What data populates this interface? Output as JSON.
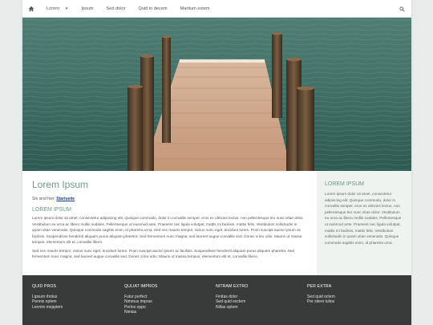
{
  "nav": {
    "items": [
      {
        "label": "Lorem",
        "has_dropdown": true
      },
      {
        "label": "Ipsum"
      },
      {
        "label": "Sed dolor"
      },
      {
        "label": "Quid in decem"
      },
      {
        "label": "Martium extem"
      }
    ],
    "home_icon": "home-icon",
    "search_icon": "search-icon"
  },
  "main": {
    "title": "Lorem Ipsum",
    "breadcrumb_prefix": "Sie sind hier:",
    "breadcrumb_link": "Startseite",
    "subtitle": "LOREM IPSUM",
    "paragraphs": [
      "Lorem ipsum dolor sit amet, consectetur adipiscing elit. Quisque commodo, dolor in convallis semper, eros ex ultricies lectus, non pellentesque leo nunc vitae dolor. Vestibulum eu urna ac libero mollis sodales. Pellentesque ut euismod ante. Praesent nec ligula volutpat, mattis mi facilisis, mattis felis. Vestibulum sollicitudin in quam vitae venenatis. Quisque commodo sagittis enim, id pharetra urna. Sed nec mauris tempor, varius nunc eget, tincidunt lorem. Proin suscipit auctor ipsum ac facilisis. Suspendisse hendrerit aliquam purus aliquam pharetra. Sed fermentum nunc magna, sed laoreet augue convallis sed. Donec a leo odio. Mauris ut massa tempus, elementum elit et, convallis libero.",
      "Sed nec mauris tempor, varius nunc eget, tincidunt lorem. Proin suscipit auctor ipsum ac facilisis. Suspendisse hendrerit aliquam purus aliquam pharetra. Sed fermentum nunc magna, sed laoreet augue convallis sed. Donec a leo odio. Mauris ut massa tempus, elementum elit et, convallis libero."
    ]
  },
  "sidebar": {
    "title": "LOREM IPSUM",
    "text": "Lorem ipsum dolor sit amet, consectetur adipiscing elit. Quisque commodo, dolor in convallis semper, eros ex ultricies lectus, non pellentesque leo nunc vitae dolor. Vestibulum eu urna ac libero mollis sodales. Pellentesque ut euismod ante. Praesent nec ligula volutpat, mattis mi facilisis, mattis felis. Vestibulum sollicitudin in quam vitae venenatis. Quisque commodo sagittis enim, id pharetra urna."
  },
  "footer": {
    "columns": [
      {
        "heading": "QUID PROS",
        "links": [
          "Lipsum rhotus",
          "Pennix optem",
          "Lenmix mopptem"
        ]
      },
      {
        "heading": "QULIAT IMPROS",
        "links": [
          "Futur perfect",
          "Nimmus impras",
          "Perlox oppo",
          "Nimias"
        ]
      },
      {
        "heading": "NITRAM EXTRO",
        "links": [
          "Finitas dolor",
          "Sed quid exctem",
          "Nillas optem"
        ]
      },
      {
        "heading": "PER EXTRA",
        "links": [
          "Sed quid octem",
          "Per sitem tulios"
        ]
      }
    ]
  },
  "colors": {
    "accent": "#6e9a86",
    "link": "#1a3d78",
    "footer_bg": "#393b3b",
    "sidebar_bg": "#eef3ef",
    "page_bg": "#e9ecea"
  }
}
